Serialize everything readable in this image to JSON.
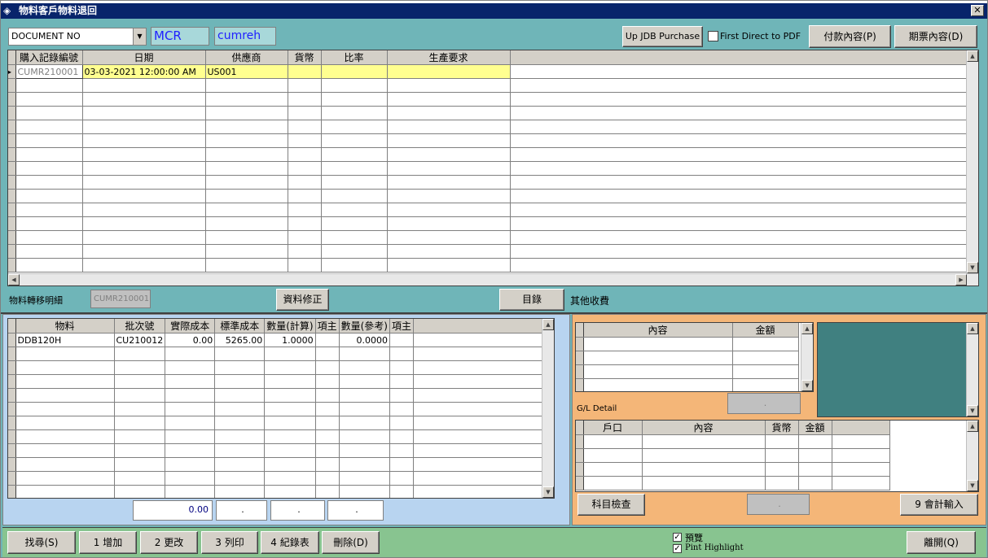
{
  "window": {
    "title": "物料客戶物料退回",
    "close": "✕"
  },
  "toolbar": {
    "doc_select": "DOCUMENT NO",
    "field1": "MCR",
    "field2": "cumreh",
    "up_jdb": "Up JDB Purchase",
    "pdf_label": "First Direct to PDF",
    "pay_btn": "付款內容(P)",
    "bill_btn": "期票內容(D)"
  },
  "main_grid": {
    "columns": [
      "購入記錄編號",
      "日期",
      "供應商",
      "貨幣",
      "比率",
      "生產要求"
    ],
    "rows": [
      [
        "CUMR210001",
        "03-03-2021 12:00:00 AM",
        "US001",
        "",
        "",
        ""
      ]
    ]
  },
  "mid": {
    "detail_label": "物料轉移明細",
    "detail_value": "CUMR210001",
    "fix_btn": "資料修正",
    "index_btn": "目錄",
    "other_label": "其他收費"
  },
  "item_grid": {
    "columns": [
      "物料",
      "批次號",
      "實際成本",
      "標準成本",
      "數量(計算)",
      "項主",
      "數量(參考)",
      "項主"
    ],
    "rows": [
      [
        "DDB120H",
        "CU210012",
        "0.00",
        "5265.00",
        "1.0000",
        "",
        "0.0000",
        ""
      ]
    ]
  },
  "totals": {
    "t1": "0.00",
    "t2": ".",
    "t3": ".",
    "t4": "."
  },
  "charge_grid": {
    "columns": [
      "內容",
      "金額"
    ],
    "total": "."
  },
  "gl": {
    "label": "G/L Detail",
    "columns": [
      "戶口",
      "內容",
      "貨幣",
      "金額"
    ],
    "check_btn": "科目檢查",
    "total": ".",
    "input_btn": "9 會計輸入"
  },
  "bottom": {
    "search": "找尋(S)",
    "add": "1 增加",
    "edit": "2 更改",
    "print": "3 列印",
    "record": "4 紀錄表",
    "delete": "刪除(D)",
    "preview": "預覽",
    "highlight": "Pint Highlight",
    "exit": "離開(Q)"
  }
}
